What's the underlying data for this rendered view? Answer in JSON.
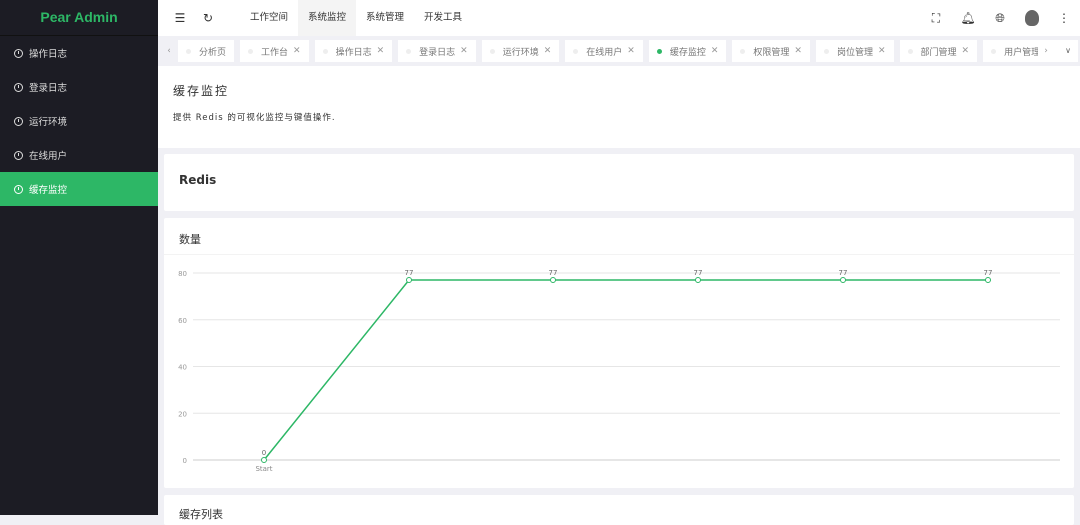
{
  "sidebar": {
    "logo": "Pear Admin",
    "items": [
      {
        "label": "操作日志"
      },
      {
        "label": "登录日志"
      },
      {
        "label": "运行环境"
      },
      {
        "label": "在线用户"
      },
      {
        "label": "缓存监控",
        "active": true
      }
    ]
  },
  "header": {
    "menus": [
      "工作空间",
      "系统监控",
      "系统管理",
      "开发工具"
    ],
    "active_menu": 1
  },
  "tabs": [
    {
      "label": "分析页",
      "closable": false
    },
    {
      "label": "工作台",
      "closable": true
    },
    {
      "label": "操作日志",
      "closable": true
    },
    {
      "label": "登录日志",
      "closable": true
    },
    {
      "label": "运行环境",
      "closable": true
    },
    {
      "label": "在线用户",
      "closable": true
    },
    {
      "label": "缓存监控",
      "closable": true,
      "active": true
    },
    {
      "label": "权限管理",
      "closable": true
    },
    {
      "label": "岗位管理",
      "closable": true
    },
    {
      "label": "部门管理",
      "closable": true
    },
    {
      "label": "用户管理",
      "closable": true
    }
  ],
  "page": {
    "title": "缓存监控",
    "description": "提供 Redis 的可视化监控与键值操作."
  },
  "redis_card": {
    "title": "Redis"
  },
  "count_card": {
    "title": "数量"
  },
  "list_card": {
    "title": "缓存列表"
  },
  "colors": {
    "accent": "#2db766",
    "sidebar": "#1c1c24"
  },
  "chart_data": {
    "type": "line",
    "title": "数量",
    "categories": [
      "Start",
      "",
      "",
      "",
      "",
      ""
    ],
    "values": [
      0,
      77,
      77,
      77,
      77,
      77
    ],
    "ylim": [
      0,
      80
    ],
    "yticks": [
      0,
      20,
      40,
      60,
      80
    ],
    "grid": true,
    "data_labels": true,
    "color": "#2db766"
  }
}
